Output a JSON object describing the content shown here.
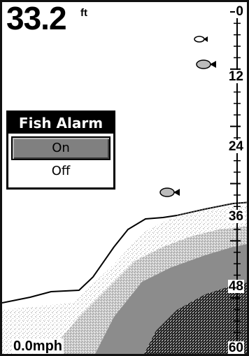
{
  "depth": {
    "value": "33.2",
    "unit": "ft"
  },
  "speed": {
    "value": "0.0mph"
  },
  "depth_scale": {
    "labels": [
      "0",
      "12",
      "24",
      "36",
      "48",
      "60"
    ],
    "min": 0,
    "max": 60
  },
  "fish_alarm_menu": {
    "title": "Fish Alarm",
    "options": [
      {
        "label": "On",
        "selected": true
      },
      {
        "label": "Off",
        "selected": false
      }
    ]
  },
  "fish_targets": [
    {
      "name": "fish-icon",
      "size": "small"
    },
    {
      "name": "fish-icon",
      "size": "medium"
    },
    {
      "name": "fish-icon",
      "size": "medium"
    }
  ],
  "colors": {
    "background": "#ffffff",
    "ink": "#000000",
    "bottom_light": "#c8c8c8",
    "bottom_mid": "#8c8c8c",
    "bottom_dark": "#1e1e1e",
    "selection": "#808080"
  }
}
